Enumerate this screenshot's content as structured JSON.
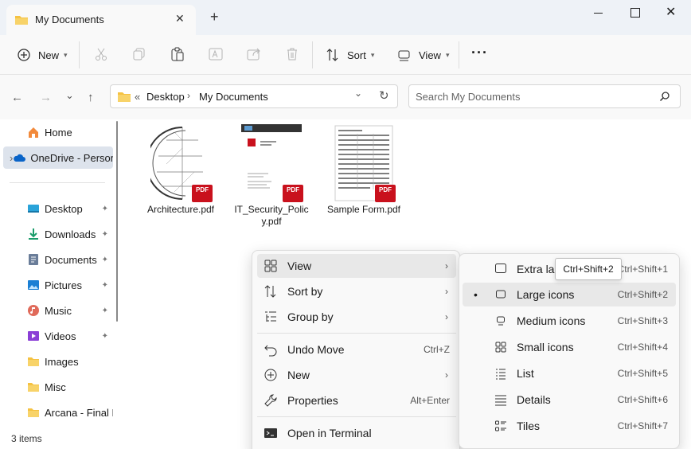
{
  "window": {
    "tab_title": "My Documents",
    "tab_close": "✕",
    "new_tab": "+",
    "close": "✕"
  },
  "toolbar": {
    "new_label": "New",
    "sort_label": "Sort",
    "view_label": "View",
    "more": "···"
  },
  "address": {
    "overflow": "«",
    "segments": [
      "Desktop",
      "My Documents"
    ],
    "sep": "›",
    "dropdown": "⌄",
    "refresh": "↻"
  },
  "search": {
    "placeholder": "Search My Documents"
  },
  "nav": {
    "back": "←",
    "forward": "→",
    "recent": "⌄",
    "up": "↑"
  },
  "sidebar": {
    "items": [
      {
        "label": "Home"
      },
      {
        "label": "OneDrive - Personal"
      },
      {
        "label": "Desktop"
      },
      {
        "label": "Downloads"
      },
      {
        "label": "Documents"
      },
      {
        "label": "Pictures"
      },
      {
        "label": "Music"
      },
      {
        "label": "Videos"
      },
      {
        "label": "Images"
      },
      {
        "label": "Misc"
      },
      {
        "label": "Arcana - Final Draft"
      }
    ],
    "expand_glyph": "›",
    "pin_glyph": "📌"
  },
  "files": [
    {
      "name": "Architecture.pdf"
    },
    {
      "name": "IT_Security_Policy.pdf"
    },
    {
      "name": "Sample Form.pdf"
    }
  ],
  "pdf_badge": "PDF",
  "status": {
    "count": "3 items"
  },
  "context_menu": {
    "items": [
      {
        "label": "View",
        "has_sub": true
      },
      {
        "label": "Sort by",
        "has_sub": true
      },
      {
        "label": "Group by",
        "has_sub": true
      },
      {
        "label": "Undo Move",
        "shortcut": "Ctrl+Z"
      },
      {
        "label": "New",
        "has_sub": true
      },
      {
        "label": "Properties",
        "shortcut": "Alt+Enter"
      },
      {
        "label": "Open in Terminal"
      }
    ],
    "arrow": "›"
  },
  "view_submenu": {
    "items": [
      {
        "label": "Extra large icons",
        "shortcut": "Ctrl+Shift+1"
      },
      {
        "label": "Large icons",
        "shortcut": "Ctrl+Shift+2",
        "selected": true
      },
      {
        "label": "Medium icons",
        "shortcut": "Ctrl+Shift+3"
      },
      {
        "label": "Small icons",
        "shortcut": "Ctrl+Shift+4"
      },
      {
        "label": "List",
        "shortcut": "Ctrl+Shift+5"
      },
      {
        "label": "Details",
        "shortcut": "Ctrl+Shift+6"
      },
      {
        "label": "Tiles",
        "shortcut": "Ctrl+Shift+7"
      }
    ],
    "bullet": "•"
  },
  "tooltip": {
    "text": "Ctrl+Shift+2"
  },
  "colors": {
    "accent": "#0067c0",
    "folder": "#f5c242",
    "pdf": "#c9111d"
  }
}
